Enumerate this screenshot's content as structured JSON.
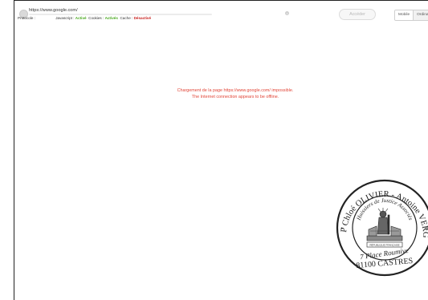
{
  "toolbar": {
    "url": "https://www.google.com/",
    "protocol_label": "Protocole :",
    "javascript_label": "Javascript :",
    "javascript_value": "Activé",
    "cookies_label": "Cookies :",
    "cookies_value": "Activés",
    "cache_label": "Cache :",
    "cache_value": "Désactivé",
    "go_label": "Accéder",
    "mode_mobile": "Mobile",
    "mode_desktop": "Ordinat"
  },
  "error": {
    "line1": "Chargement de la page https://www.google.com/ impossible.",
    "line2": "The Internet connection appears to be offline."
  },
  "seal": {
    "ring_text": "SCP Chloé OLIVIER - Antoine VERGE",
    "inner_text": "Huissiers de Justice Associés",
    "republic": "RÉPUBLIQUE FRANÇAISE",
    "address1": "7 Place Roumive",
    "address2": "81100 CASTRES"
  },
  "colors": {
    "active": "#49a81e",
    "inactive": "#c8201e",
    "error": "#e24638"
  }
}
